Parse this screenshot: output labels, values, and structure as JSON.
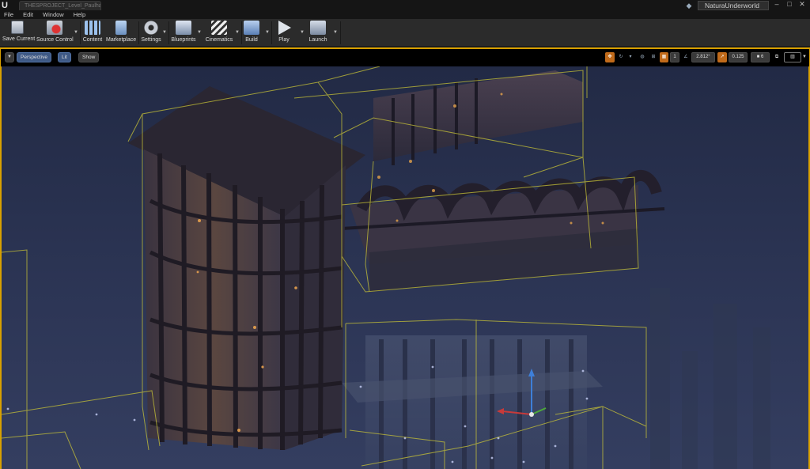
{
  "window": {
    "doc_tab": "THESPROJECT_Level_Paulhang",
    "project_name": "NaturaUnderworld",
    "controls": [
      "–",
      "□",
      "✕"
    ]
  },
  "menu": [
    "File",
    "Edit",
    "Window",
    "Help"
  ],
  "toolbar": {
    "save_current": "Save Current",
    "source_control": "Source Control",
    "content": "Content",
    "marketplace": "Marketplace",
    "settings": "Settings",
    "blueprints": "Blueprints",
    "cinematics": "Cinematics",
    "build": "Build",
    "play": "Play",
    "launch": "Launch"
  },
  "viewport": {
    "perspective": "Perspective",
    "lit": "Lit",
    "show": "Show",
    "grid_snap": "1",
    "rotation_snap": "2.812°",
    "scale_snap": "0.125",
    "camera_speed": "6"
  },
  "colors": {
    "accent": "#d8a000",
    "scene_bg": "#2a324e",
    "bounds": "#c7c236",
    "snap_on": "#c06a1a"
  }
}
